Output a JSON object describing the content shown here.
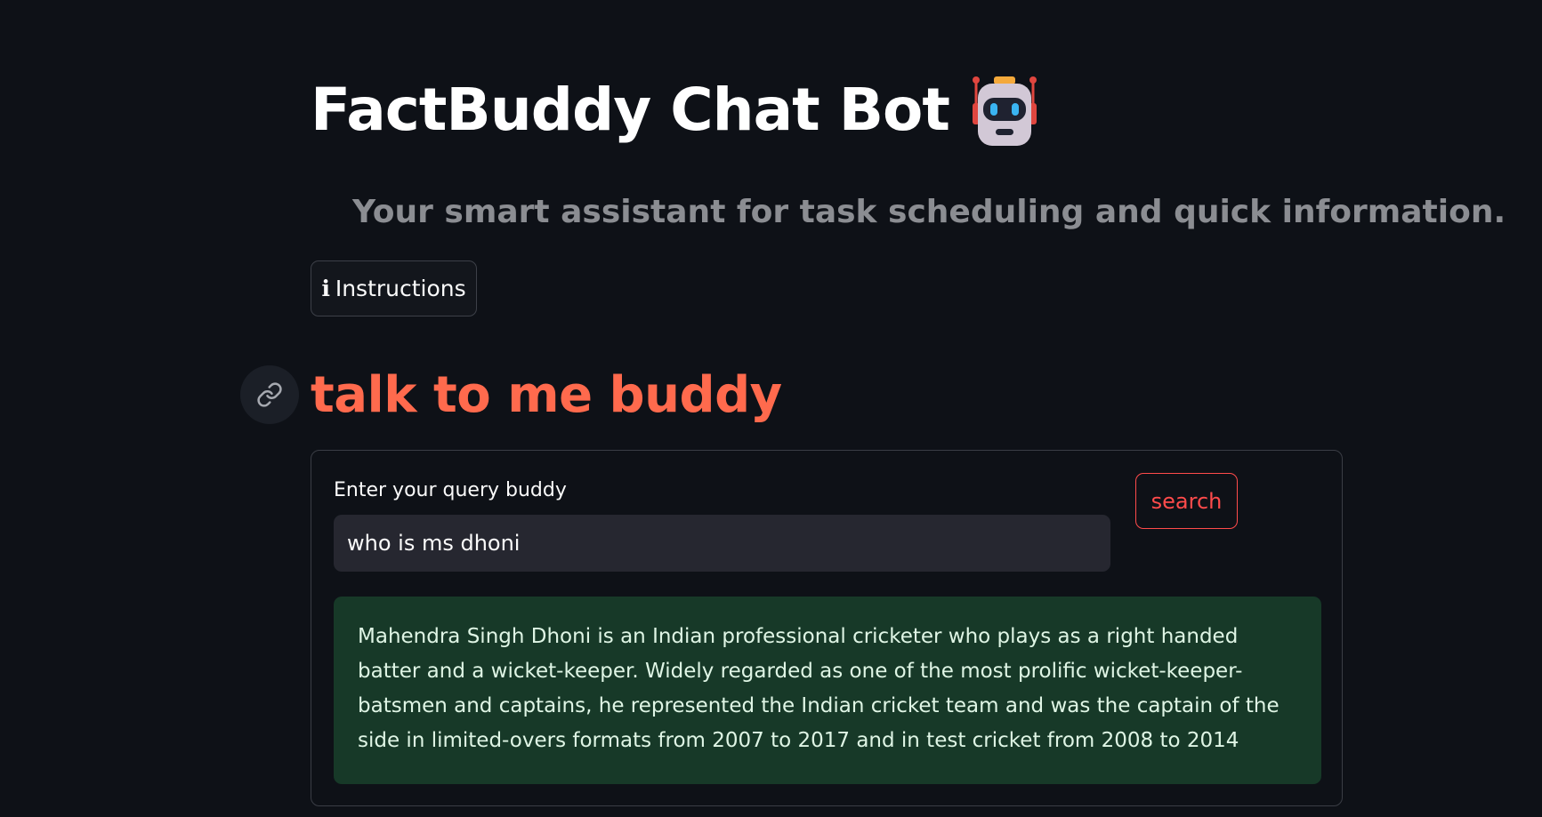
{
  "header": {
    "title": "FactBuddy Chat Bot",
    "title_icon": "robot-face-icon",
    "subtitle": "Your smart assistant for task scheduling and quick information."
  },
  "instructions": {
    "icon": "info-icon",
    "icon_glyph": "ℹ",
    "label": "Instructions"
  },
  "section": {
    "anchor_icon": "link-icon",
    "heading": "talk to me buddy"
  },
  "form": {
    "query_label": "Enter your query buddy",
    "query_value": "who is ms dhoni",
    "search_label": "search"
  },
  "answer": {
    "text": "Mahendra Singh Dhoni is an Indian professional cricketer who plays as a right handed batter and a wicket-keeper. Widely regarded as one of the most prolific wicket-keeper-batsmen and captains, he represented the Indian cricket team and was the captain of the side in limited-overs formats from 2007 to 2017 and in test cricket from 2008 to 2014"
  },
  "colors": {
    "background": "#0e1117",
    "heading_accent": "#ff6a4d",
    "button_accent": "#ff4b4b",
    "input_bg": "#262730",
    "success_bg": "#173928",
    "success_text": "#dff5e5"
  }
}
